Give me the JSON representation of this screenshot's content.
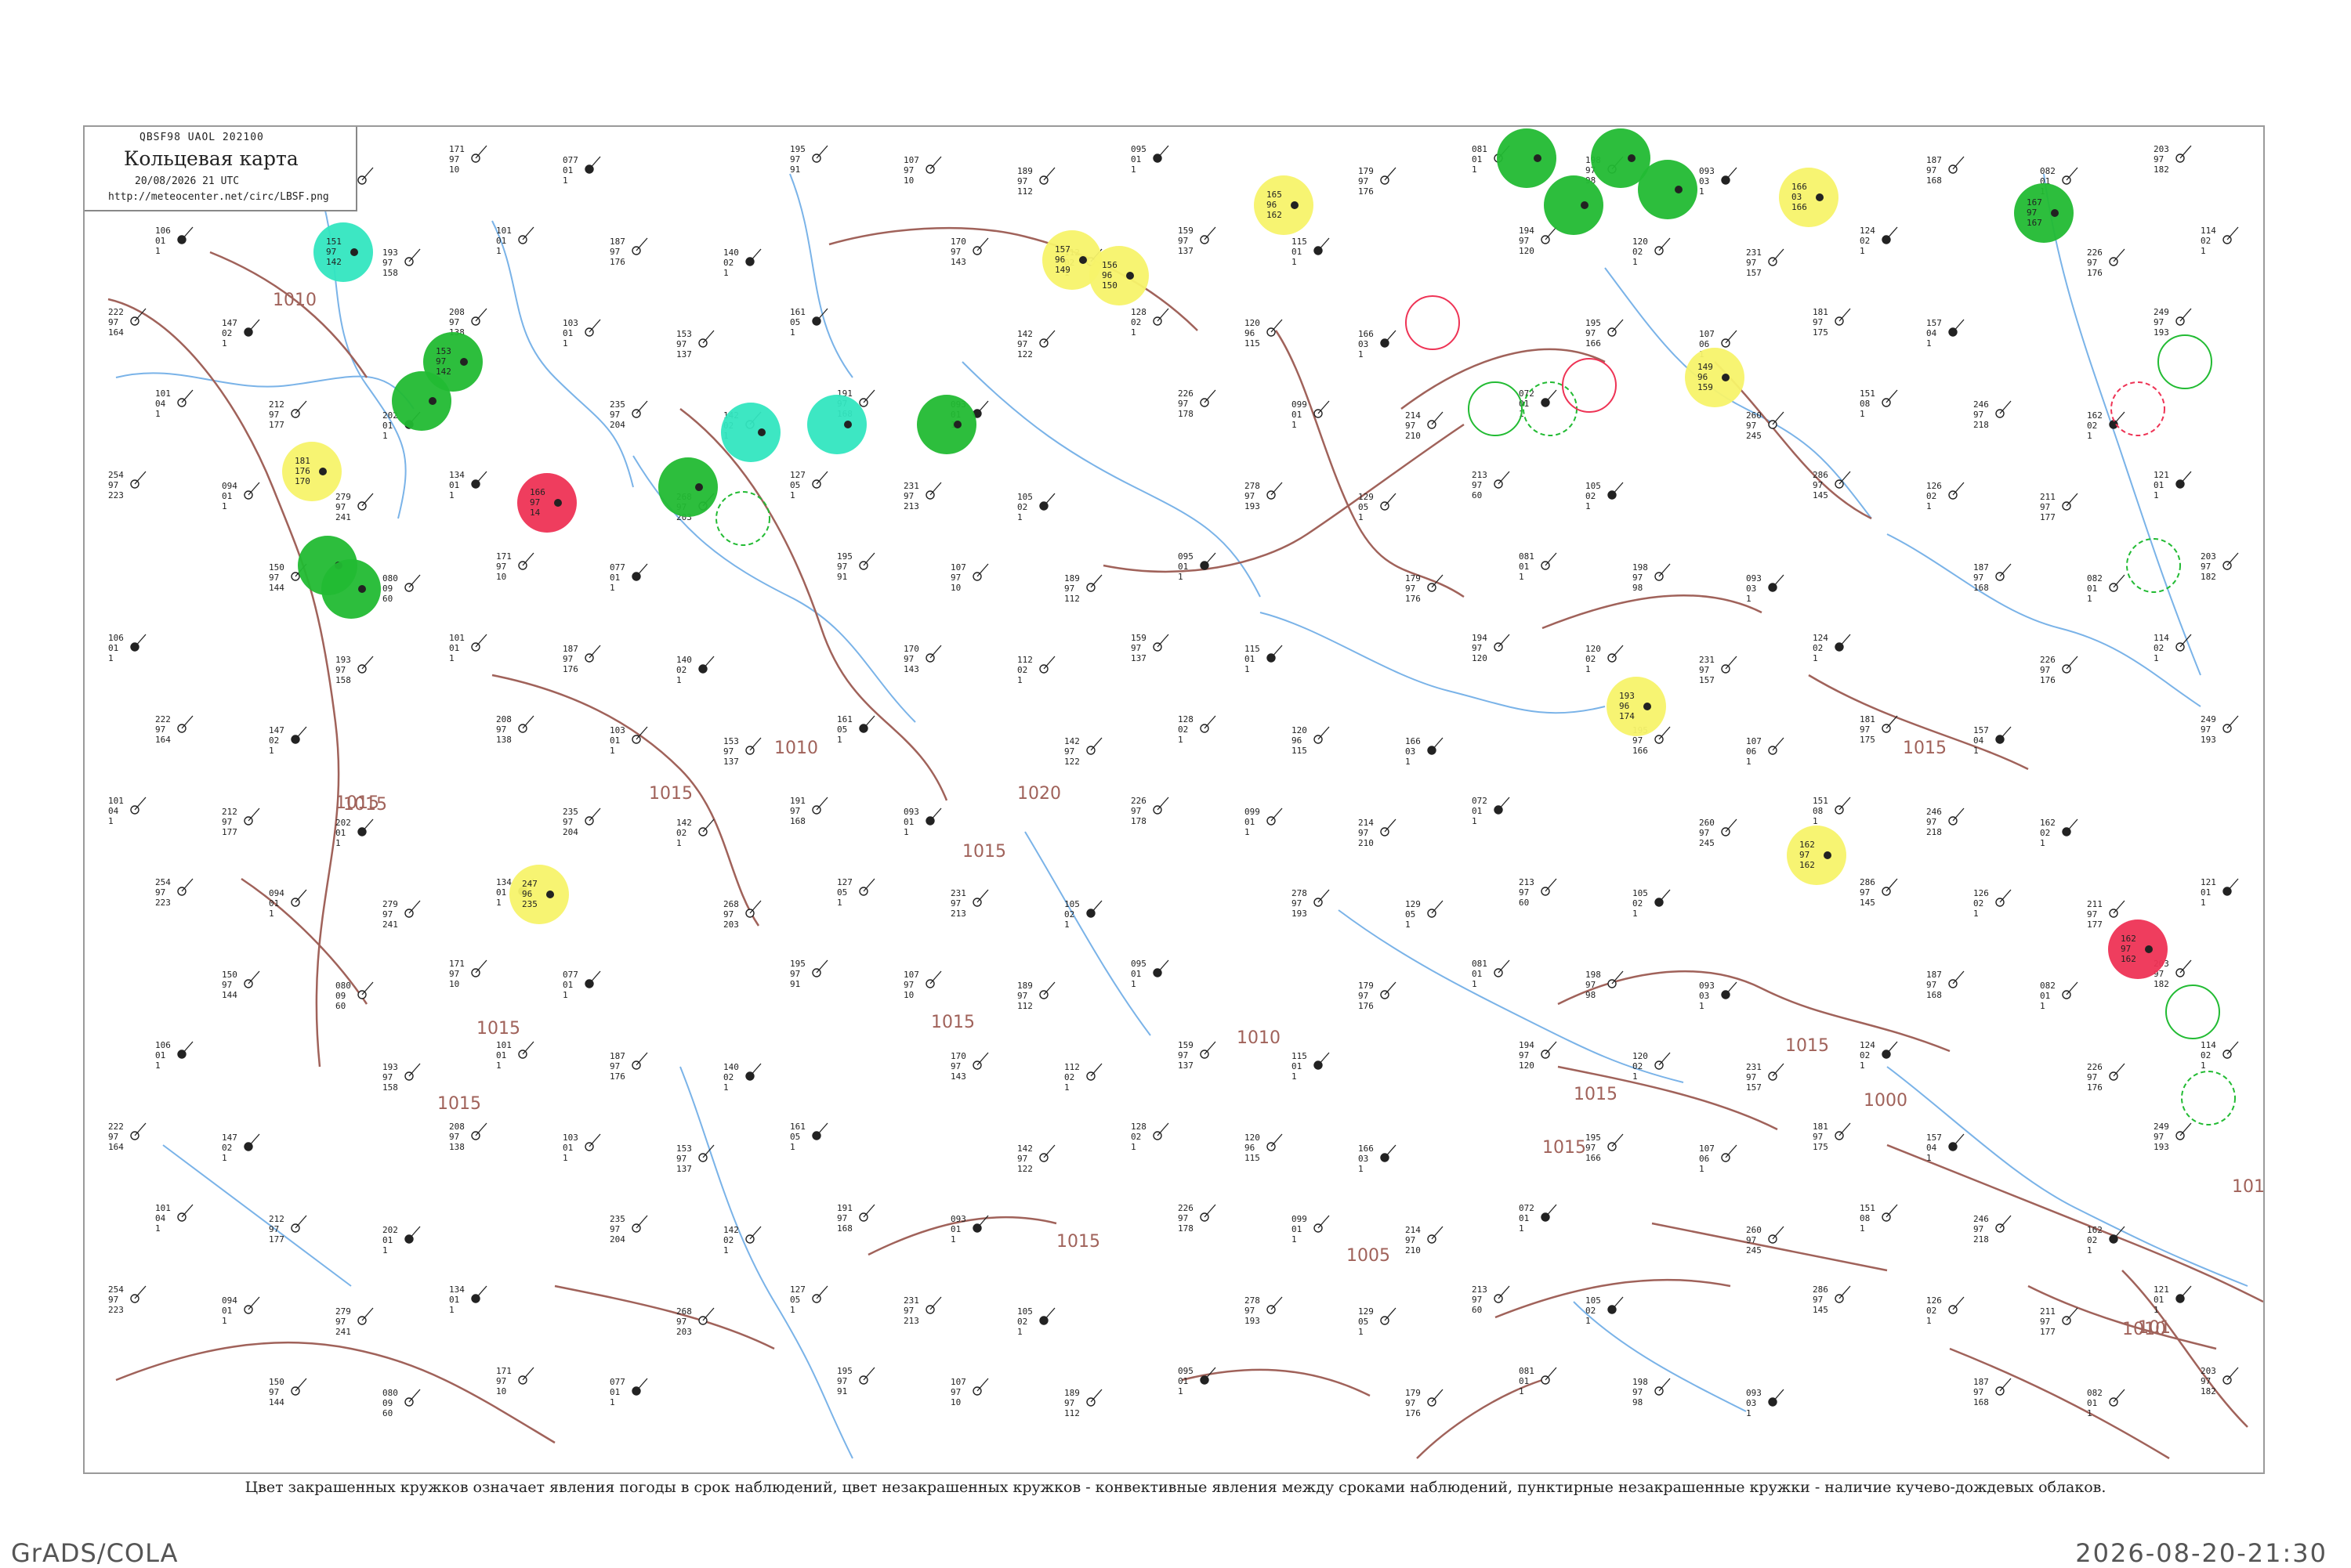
{
  "header": {
    "code_line": "QBSF98  UAOL  202100",
    "title": "Кольцевая карта",
    "timestamp": "20/08/2026 21 UTC",
    "url": "http://meteocenter.net/circ/LBSF.png"
  },
  "caption": "Цвет закрашенных кружков означает явления погоды в срок наблюдений, цвет незакрашенных кружков - конвективные явления между сроками наблюдений, пунктирные незакрашенные кружки - наличие кучево-дождевых облаков.",
  "footer": {
    "left": "GrADS/COLA",
    "right": "2026-08-20-21:30"
  },
  "colors": {
    "rain": "#22bb33",
    "shower": "#33e6c0",
    "fog": "#f7f36a",
    "thunder": "#ee3355",
    "isobar": "#a0625a",
    "river": "#7ab3e8",
    "frame": "#9a9a9a"
  },
  "isobar_labels": [
    "1010",
    "1015",
    "1015",
    "1015",
    "1015",
    "1015",
    "1010",
    "1015",
    "1020",
    "1015",
    "1010",
    "1015",
    "1005",
    "1015",
    "1000",
    "1015",
    "101",
    "1010",
    "1010",
    "1015",
    "1015"
  ],
  "highlight_stations": [
    {
      "kind": "rain",
      "values": [
        "153",
        "97",
        "142"
      ]
    },
    {
      "kind": "shower",
      "values": [
        "151",
        "97",
        "142"
      ]
    },
    {
      "kind": "thunder",
      "values": [
        "166",
        "97",
        "14"
      ]
    },
    {
      "kind": "fog",
      "values": [
        "181",
        "176",
        "170"
      ]
    },
    {
      "kind": "fog",
      "values": [
        "247",
        "96",
        "235"
      ]
    },
    {
      "kind": "fog",
      "values": [
        "165",
        "96",
        "162"
      ]
    },
    {
      "kind": "fog",
      "values": [
        "157",
        "96",
        "149"
      ]
    },
    {
      "kind": "fog",
      "values": [
        "156",
        "96",
        "150"
      ]
    },
    {
      "kind": "fog",
      "values": [
        "149",
        "96",
        "159"
      ]
    },
    {
      "kind": "fog",
      "values": [
        "193",
        "96",
        "174"
      ]
    },
    {
      "kind": "fog",
      "values": [
        "162",
        "97",
        "162"
      ]
    },
    {
      "kind": "fog",
      "values": [
        "166",
        "03",
        "166"
      ]
    },
    {
      "kind": "thunder",
      "values": [
        "162",
        "97",
        "162"
      ]
    },
    {
      "kind": "rain",
      "values": [
        "167",
        "97",
        "167"
      ]
    }
  ],
  "station_samples": [
    [
      "150",
      "97",
      "144"
    ],
    [
      "080",
      "09",
      "60"
    ],
    [
      "171",
      "97",
      "10"
    ],
    [
      "077",
      "01",
      "1"
    ],
    [
      "195",
      "97",
      "91"
    ],
    [
      "107",
      "97",
      "10"
    ],
    [
      "189",
      "97",
      "112"
    ],
    [
      "095",
      "01",
      "1"
    ],
    [
      "179",
      "97",
      "176"
    ],
    [
      "081",
      "01",
      "1"
    ],
    [
      "198",
      "97",
      "98"
    ],
    [
      "093",
      "03",
      "1"
    ],
    [
      "187",
      "97",
      "168"
    ],
    [
      "082",
      "01",
      "1"
    ],
    [
      "203",
      "97",
      "182"
    ],
    [
      "106",
      "01",
      "1"
    ],
    [
      "193",
      "97",
      "158"
    ],
    [
      "101",
      "01",
      "1"
    ],
    [
      "187",
      "97",
      "176"
    ],
    [
      "140",
      "02",
      "1"
    ],
    [
      "170",
      "97",
      "143"
    ],
    [
      "112",
      "02",
      "1"
    ],
    [
      "159",
      "97",
      "137"
    ],
    [
      "115",
      "01",
      "1"
    ],
    [
      "194",
      "97",
      "120"
    ],
    [
      "120",
      "02",
      "1"
    ],
    [
      "231",
      "97",
      "157"
    ],
    [
      "124",
      "02",
      "1"
    ],
    [
      "226",
      "97",
      "176"
    ],
    [
      "114",
      "02",
      "1"
    ],
    [
      "222",
      "97",
      "164"
    ],
    [
      "147",
      "02",
      "1"
    ],
    [
      "208",
      "97",
      "138"
    ],
    [
      "103",
      "01",
      "1"
    ],
    [
      "153",
      "97",
      "137"
    ],
    [
      "161",
      "05",
      "1"
    ],
    [
      "142",
      "97",
      "122"
    ],
    [
      "128",
      "02",
      "1"
    ],
    [
      "120",
      "96",
      "115"
    ],
    [
      "166",
      "03",
      "1"
    ],
    [
      "195",
      "97",
      "166"
    ],
    [
      "107",
      "06",
      "1"
    ],
    [
      "181",
      "97",
      "175"
    ],
    [
      "157",
      "04",
      "1"
    ],
    [
      "249",
      "97",
      "193"
    ],
    [
      "101",
      "04",
      "1"
    ],
    [
      "212",
      "97",
      "177"
    ],
    [
      "202",
      "01",
      "1"
    ],
    [
      "235",
      "97",
      "204"
    ],
    [
      "142",
      "02",
      "1"
    ],
    [
      "191",
      "97",
      "168"
    ],
    [
      "093",
      "01",
      "1"
    ],
    [
      "226",
      "97",
      "178"
    ],
    [
      "099",
      "01",
      "1"
    ],
    [
      "214",
      "97",
      "210"
    ],
    [
      "072",
      "01",
      "1"
    ],
    [
      "260",
      "97",
      "245"
    ],
    [
      "151",
      "08",
      "1"
    ],
    [
      "246",
      "97",
      "218"
    ],
    [
      "162",
      "02",
      "1"
    ],
    [
      "254",
      "97",
      "223"
    ],
    [
      "094",
      "01",
      "1"
    ],
    [
      "279",
      "97",
      "241"
    ],
    [
      "134",
      "01",
      "1"
    ],
    [
      "268",
      "97",
      "203"
    ],
    [
      "127",
      "05",
      "1"
    ],
    [
      "231",
      "97",
      "213"
    ],
    [
      "105",
      "02",
      "1"
    ],
    [
      "278",
      "97",
      "193"
    ],
    [
      "129",
      "05",
      "1"
    ],
    [
      "213",
      "97",
      "60"
    ],
    [
      "105",
      "02",
      "1"
    ],
    [
      "286",
      "97",
      "145"
    ],
    [
      "126",
      "02",
      "1"
    ],
    [
      "211",
      "97",
      "177"
    ],
    [
      "121",
      "01",
      "1"
    ]
  ]
}
